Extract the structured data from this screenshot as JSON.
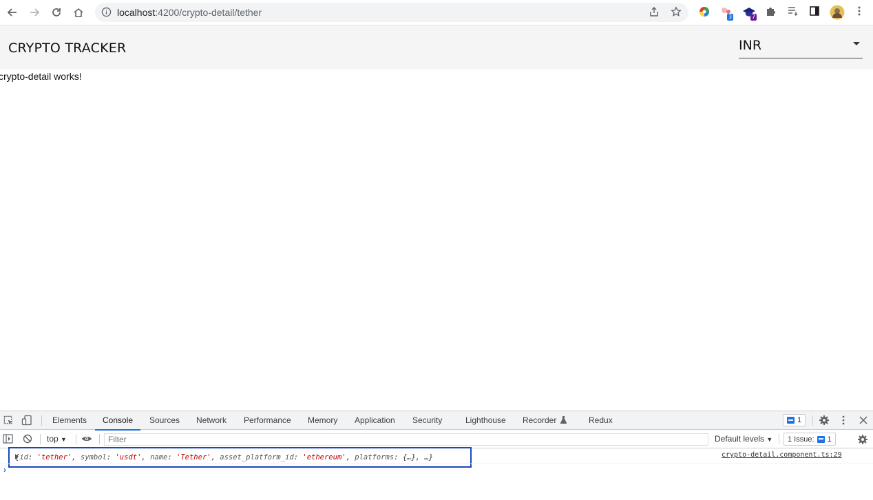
{
  "browser": {
    "url_host": "localhost",
    "url_path": ":4200/crypto-detail/tether",
    "extensions": [
      {
        "icon": "color-wheel-icon"
      },
      {
        "icon": "extension-badge-icon",
        "badge": "3"
      },
      {
        "icon": "graduation-cap-icon",
        "badge": "7"
      },
      {
        "icon": "puzzle-icon"
      },
      {
        "icon": "reading-list-icon"
      },
      {
        "icon": "side-panel-icon"
      },
      {
        "icon": "profile-avatar-icon"
      }
    ]
  },
  "app": {
    "title": "CRYPTO TRACKER",
    "currency": "INR",
    "body_text": "crypto-detail works!"
  },
  "devtools": {
    "tabs": [
      "Elements",
      "Console",
      "Sources",
      "Network",
      "Performance",
      "Memory",
      "Application",
      "Security",
      "Lighthouse",
      "Recorder",
      "Redux"
    ],
    "active_tab": "Console",
    "messages_count": "1",
    "context": "top",
    "filter_placeholder": "Filter",
    "levels": "Default levels",
    "issues_label": "1 Issue:",
    "issues_count": "1",
    "log": {
      "k1": "id",
      "v1": "'tether'",
      "k2": "symbol",
      "v2": "'usdt'",
      "k3": "name",
      "v3": "'Tether'",
      "k4": "asset_platform_id",
      "v4": "'ethereum'",
      "k5": "platforms",
      "v5": "{…}",
      "tail": "…",
      "source": "crypto-detail.component.ts:29"
    }
  }
}
